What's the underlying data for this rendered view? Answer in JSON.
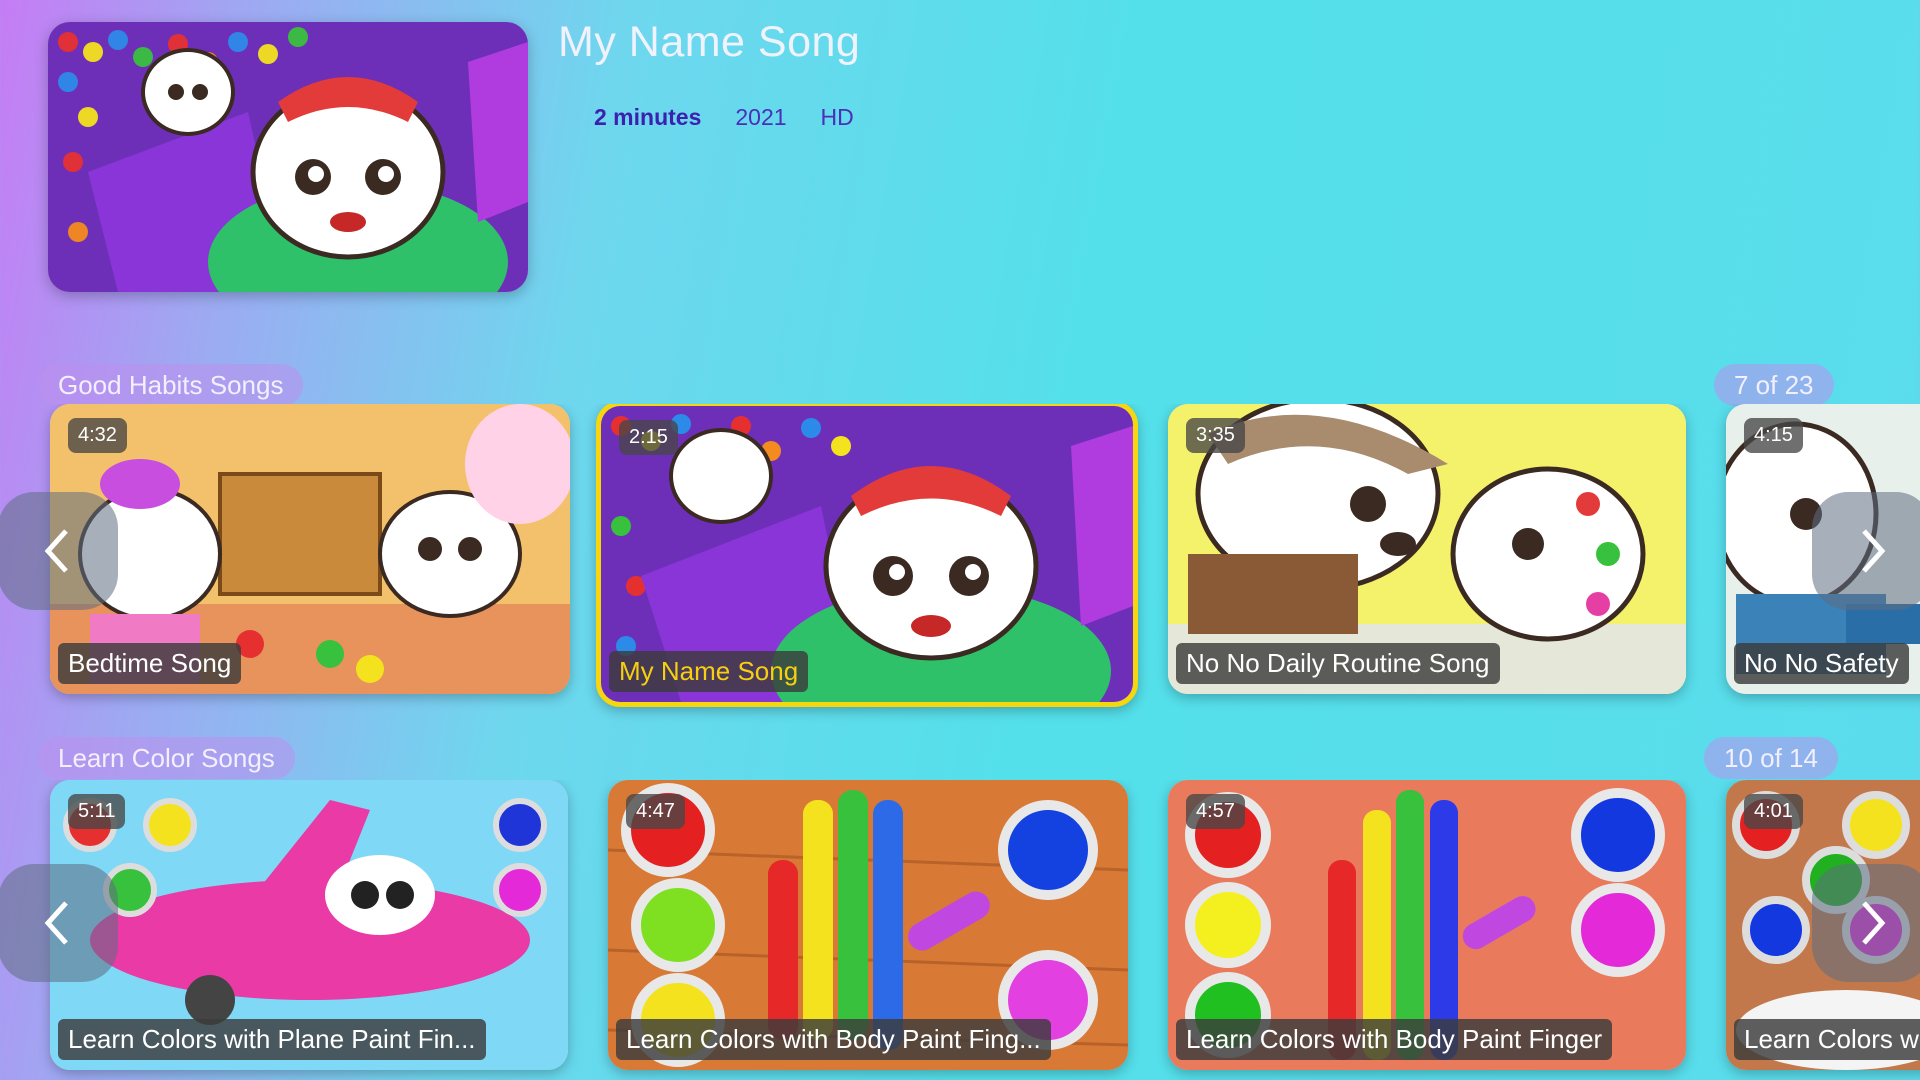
{
  "hero": {
    "title": "My Name Song",
    "duration": "2 minutes",
    "year": "2021",
    "quality": "HD"
  },
  "rows": [
    {
      "title": "Good Habits Songs",
      "counter": "7 of 23",
      "cards": [
        {
          "duration": "4:32",
          "title": "Bedtime Song",
          "colors": [
            "#f3c16b",
            "#e7935b"
          ]
        },
        {
          "duration": "2:15",
          "title": "My Name Song",
          "colors": [
            "#7fc05a",
            "#a235d3"
          ],
          "selected": true
        },
        {
          "duration": "3:35",
          "title": "No No Daily Routine Song",
          "colors": [
            "#f4f26a",
            "#e5e8d8"
          ]
        },
        {
          "duration": "4:15",
          "title": "No No Safety",
          "colors": [
            "#e8f0ec",
            "#7aa2b3"
          ]
        }
      ]
    },
    {
      "title": "Learn Color Songs",
      "counter": "10 of 14",
      "cards": [
        {
          "duration": "5:11",
          "title": "Learn Colors with Plane Paint Fin...",
          "colors": [
            "#7fd8f6",
            "#e93aa5"
          ]
        },
        {
          "duration": "4:47",
          "title": "Learn Colors with Body Paint Fing...",
          "colors": [
            "#d87936",
            "#9a4d1f"
          ]
        },
        {
          "duration": "4:57",
          "title": "Learn Colors with Body Paint Finger",
          "colors": [
            "#e97a5c",
            "#c95a45"
          ]
        },
        {
          "duration": "4:01",
          "title": "Learn Colors w",
          "colors": [
            "#c2784a",
            "#9c5a30"
          ]
        }
      ]
    }
  ],
  "icons": {
    "prev": "chevron-left-icon",
    "next": "chevron-right-icon"
  },
  "colors": {
    "accent": "#f6d60c",
    "meta": "#4b2fb8"
  }
}
